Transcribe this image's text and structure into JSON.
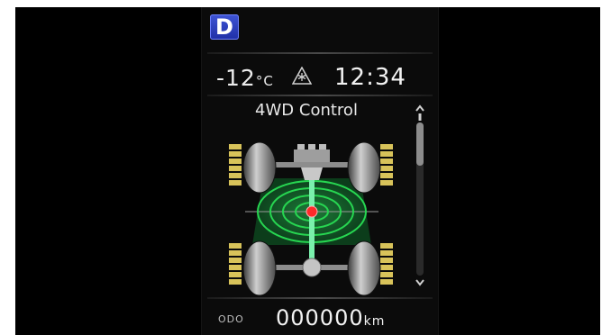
{
  "gear": {
    "position": "D"
  },
  "status": {
    "temperature_value": "-12",
    "temperature_unit": "°C",
    "clock": "12:34"
  },
  "screen": {
    "title": "4WD Control"
  },
  "odometer": {
    "label": "ODO",
    "value": "000000",
    "unit": "km"
  },
  "icons": {
    "ice_warning": "road-ice-warning-icon",
    "scroll_up": "chevron-up-icon",
    "scroll_down": "chevron-down-icon"
  },
  "colors": {
    "gear_badge": "#2e43c8",
    "traction_level": "#d8c35a",
    "radar_rings": "#27d651",
    "center_point": "#ff2a2a",
    "torque_shaft": "#7af0ac"
  }
}
